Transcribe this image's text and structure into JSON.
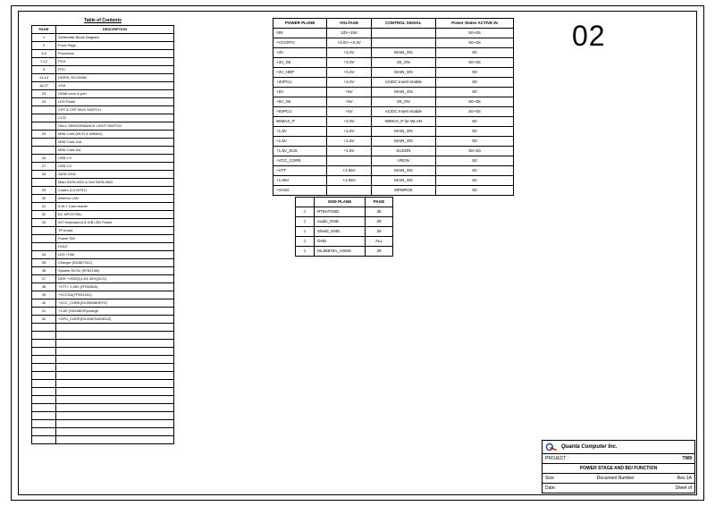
{
  "page_number": "02",
  "toc": {
    "title": "Table of Contents",
    "headers": [
      "PAGE",
      "DESCRIPTION"
    ],
    "rows": [
      [
        "1",
        "Schematic Block Diagram"
      ],
      [
        "2",
        "Front Page"
      ],
      [
        "3-6",
        "Processor"
      ],
      [
        "7-12",
        "PCH"
      ],
      [
        "9",
        "RTC"
      ],
      [
        "13-14",
        "DDR3L SO-DIMM"
      ],
      [
        "18,27",
        "VGA"
      ],
      [
        "23",
        "HDMI conn & port"
      ],
      [
        "24",
        "LED Panel"
      ],
      [
        "",
        "CRT & CRT MUX SWITCH"
      ],
      [
        "",
        "CCD"
      ],
      [
        "",
        "HALL SENSOR&BACK LIGHT SWITCH"
      ],
      [
        "25",
        "MINI Card (Wi-Fi & WiMAX)"
      ],
      [
        "",
        "MINI Card 2nd"
      ],
      [
        "",
        "MINI Card 3rd"
      ],
      [
        "26",
        "USB 2.0"
      ],
      [
        "27",
        "USB 3.0"
      ],
      [
        "28",
        "SATA ODD"
      ],
      [
        "",
        "Main SATA HDD & 2nd SATA HDD"
      ],
      [
        "29",
        "Codec (CX20757)"
      ],
      [
        "30",
        "Atheros LAN"
      ],
      [
        "31",
        "5 IN 1 Card reader"
      ],
      [
        "32",
        "EC NPCE795L"
      ],
      [
        "33",
        "INT Keyboard A & K/B LED Power"
      ],
      [
        "",
        "TP board"
      ],
      [
        "",
        "Power SW"
      ],
      [
        "",
        "HOLE"
      ],
      [
        "34",
        "LED / EMI"
      ],
      [
        "35",
        "Charger (ISL88731C)"
      ],
      [
        "36",
        "System 5V/3V (RT8210B)"
      ],
      [
        "37",
        "DDR +VDDQ(1.5/1.35V)(SLG)"
      ],
      [
        "38",
        "+VTT= 1.05V (RT8250A)"
      ],
      [
        "39",
        "+VCCSA(TPS51431)"
      ],
      [
        "40",
        "+VCC_CORE(ISL95836HRTZ)"
      ],
      [
        "41",
        "+1.8V (G5408/G5)charge"
      ],
      [
        "42",
        "+GPU_CORE(ISL95870AIHRUZ)"
      ],
      [
        "",
        ""
      ],
      [
        "",
        ""
      ],
      [
        "",
        ""
      ],
      [
        "",
        ""
      ],
      [
        "",
        ""
      ],
      [
        "",
        ""
      ],
      [
        "",
        ""
      ],
      [
        "",
        ""
      ],
      [
        "",
        ""
      ],
      [
        "",
        ""
      ],
      [
        "",
        ""
      ],
      [
        "",
        ""
      ],
      [
        "",
        ""
      ],
      [
        "",
        ""
      ],
      [
        "",
        ""
      ]
    ]
  },
  "power": {
    "headers": [
      "POWER PLANE",
      "VOLTAGE",
      "CONTROL SIGNAL",
      "Power States ACTIVE IN"
    ],
    "rows": [
      [
        "VIN",
        "10V~19V",
        "",
        "S0~S5"
      ],
      [
        "+VCCRTC",
        "+3.0V~+3.3V",
        "",
        "S0~S5"
      ],
      [
        "+3V",
        "+3.3V",
        "MAIN_ON",
        "S0"
      ],
      [
        "+3V_S5",
        "+3.3V",
        "S5_ON",
        "S0~S5"
      ],
      [
        "+3V_HDP",
        "+3.3V",
        "MAIN_ON",
        "S0"
      ],
      [
        "+3VPCU",
        "+3.3V",
        "AC/DC Insert enable",
        "S0"
      ],
      [
        "+5V",
        "+5V",
        "MAIN_ON",
        "S0"
      ],
      [
        "+5V_S5",
        "+5V",
        "S5_ON",
        "S0~S5"
      ],
      [
        "+5VPCU",
        "+5V",
        "AC/DC Insert enable",
        "S0~S5"
      ],
      [
        "WIMAX_P",
        "+3.3V",
        "WIMAX_P for WLAN",
        "S0"
      ],
      [
        "+1.8V",
        "+1.8V",
        "MAIN_ON",
        "S0"
      ],
      [
        "+1.5V",
        "+1.5V",
        "MAIN_ON",
        "S0"
      ],
      [
        "+1.5V_SUS",
        "+1.5V",
        "SUSON",
        "S0~S3"
      ],
      [
        "+VCC_CORE",
        "",
        "VRON",
        "S0"
      ],
      [
        "+VTT",
        "+1.05V",
        "MAIN_ON",
        "S0"
      ],
      [
        "+1.05V",
        "+1.05V",
        "MAIN_ON",
        "S0"
      ],
      [
        "+VAXG",
        "",
        "MPWROK",
        "S0"
      ]
    ]
  },
  "gnd": {
    "headers": [
      "GND PLANE",
      "PAGE"
    ],
    "rows": [
      [
        "⏚",
        "RTBATGND",
        "35"
      ],
      [
        "⏚",
        "Audio_GND",
        "29"
      ],
      [
        "⏚",
        "Shield_GND",
        "29"
      ],
      [
        "⏚",
        "GND",
        "ALL"
      ],
      [
        "⏚",
        "ISL95870A_AGND",
        "29"
      ]
    ]
  },
  "titleblock": {
    "company": "Quanta Computer Inc.",
    "project_label": "PROJECT :",
    "project_value": "TW9",
    "sheet_title": "POWER STAGE AND BD/ FUNCTION",
    "size_label": "Size",
    "docno_label": "Document Number",
    "rev_label": "Rev",
    "rev_value": "1A",
    "date_label": "Date:",
    "sheet_label": "Sheet",
    "sheet_value": "of"
  }
}
